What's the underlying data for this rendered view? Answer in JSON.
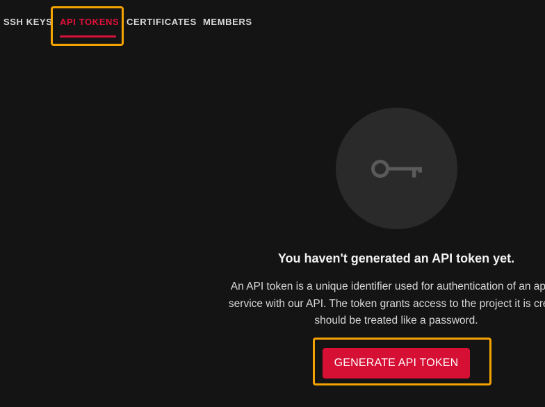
{
  "tabs": [
    {
      "label": "SSH KEYS",
      "active": false
    },
    {
      "label": "API TOKENS",
      "active": true
    },
    {
      "label": "CERTIFICATES",
      "active": false
    },
    {
      "label": "MEMBERS",
      "active": false
    }
  ],
  "empty_state": {
    "icon": "key-icon",
    "title": "You haven't generated an API token yet.",
    "description_lines": [
      "An API token is a unique identifier used for authentication of an applic",
      "service with our API. The token grants access to the project it is create",
      "should be treated like a password."
    ],
    "button_label": "GENERATE API TOKEN"
  },
  "colors": {
    "background": "#141414",
    "accent": "#d60f34",
    "highlight": "#f5a300",
    "circle": "#2a2a2a"
  }
}
